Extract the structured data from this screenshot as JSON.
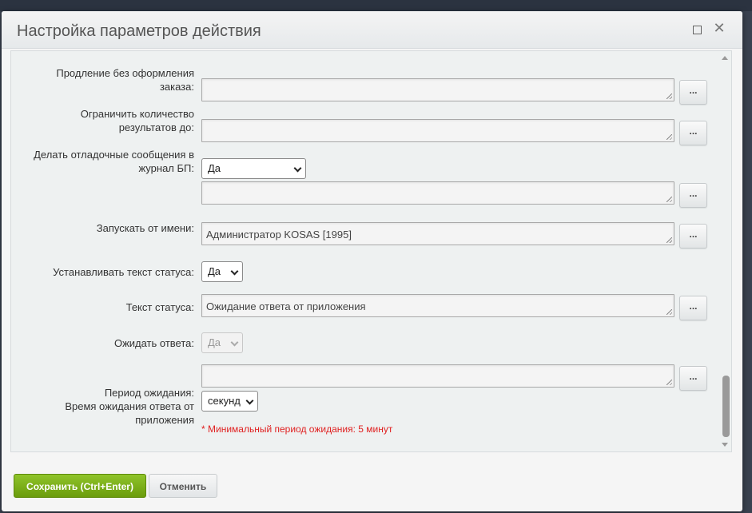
{
  "window": {
    "title": "Настройка параметров действия",
    "maximize_icon": "maximize-icon",
    "close_icon": "✕"
  },
  "fields": {
    "extension": {
      "label_line1": "Продление без оформления",
      "label_line2": "заказа:",
      "value": "",
      "dots": "..."
    },
    "limit": {
      "label_line1": "Ограничить количество",
      "label_line2": "результатов до:",
      "value": "",
      "dots": "..."
    },
    "debug": {
      "label_line1": "Делать отладочные сообщения в",
      "label_line2": "журнал БП:",
      "select_value": "Да",
      "value": "",
      "dots": "..."
    },
    "run_as": {
      "label": "Запускать от имени:",
      "value": "Администратор KOSAS [1995]",
      "dots": "..."
    },
    "set_status": {
      "label": "Устанавливать текст статуса:",
      "select_value": "Да"
    },
    "status_text": {
      "label": "Текст статуса:",
      "value": "Ожидание ответа от приложения",
      "dots": "..."
    },
    "wait_response": {
      "label": "Ожидать ответа:",
      "select_value": "Да"
    },
    "wait_period": {
      "label_line1": "Период ожидания:",
      "label_line2": "Время ожидания ответа от",
      "label_line3": "приложения",
      "value": "",
      "dots": "...",
      "unit_select": "секунд",
      "hint": "* Минимальный период ожидания: 5 минут"
    }
  },
  "footer": {
    "save_label": "Сохранить (Ctrl+Enter)",
    "cancel_label": "Отменить"
  },
  "colors": {
    "save_button": "#7cb01a",
    "hint_text": "#e02020"
  }
}
